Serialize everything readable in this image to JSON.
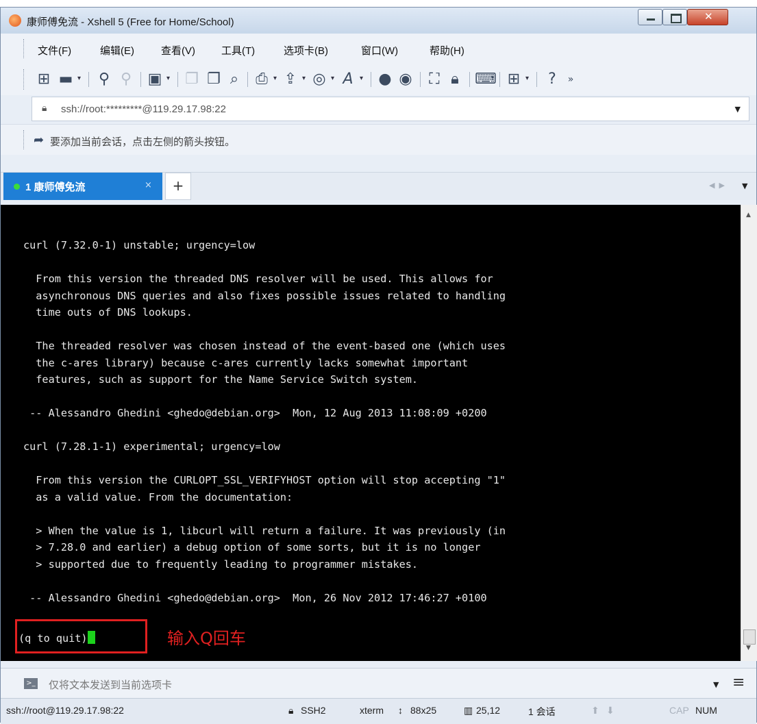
{
  "window": {
    "title": "康师傅免流 - Xshell 5 (Free for Home/School)"
  },
  "menu": [
    "文件(F)",
    "编辑(E)",
    "查看(V)",
    "工具(T)",
    "选项卡(B)",
    "窗口(W)",
    "帮助(H)"
  ],
  "toolbar": {
    "icons": [
      "new-session-icon",
      "open-folder-icon",
      "connect-icon",
      "disconnect-icon",
      "properties-icon",
      "copy-icon",
      "paste-icon",
      "find-icon",
      "print-icon",
      "transfer-icon",
      "globe-icon",
      "font-icon",
      "xftp-icon",
      "xagent-icon",
      "fullscreen-icon",
      "lock-icon",
      "keyboard-icon",
      "compose-icon",
      "help-icon",
      "overflow-icon"
    ]
  },
  "address": {
    "value": "ssh://root:*********@119.29.17.98:22"
  },
  "hint": {
    "text": "要添加当前会话，点击左侧的箭头按钮。"
  },
  "tabs": {
    "active_label": "1 康师傅免流",
    "add": "+"
  },
  "terminal": {
    "lines": [
      "curl (7.32.0-1) unstable; urgency=low",
      "",
      "  From this version the threaded DNS resolver will be used. This allows for",
      "  asynchronous DNS queries and also fixes possible issues related to handling",
      "  time outs of DNS lookups.",
      "",
      "  The threaded resolver was chosen instead of the event-based one (which uses",
      "  the c-ares library) because c-ares currently lacks somewhat important",
      "  features, such as support for the Name Service Switch system.",
      "",
      " -- Alessandro Ghedini <ghedo@debian.org>  Mon, 12 Aug 2013 11:08:09 +0200",
      "",
      "curl (7.28.1-1) experimental; urgency=low",
      "",
      "  From this version the CURLOPT_SSL_VERIFYHOST option will stop accepting \"1\"",
      "  as a valid value. From the documentation:",
      "",
      "  > When the value is 1, libcurl will return a failure. It was previously (in",
      "  > 7.28.0 and earlier) a debug option of some sorts, but it is no longer",
      "  > supported due to frequently leading to programmer mistakes.",
      "",
      " -- Alessandro Ghedini <ghedo@debian.org>  Mon, 26 Nov 2012 17:46:27 +0100"
    ],
    "prompt": "(q to quit)",
    "annotation": "输入Q回车"
  },
  "sendbar": {
    "placeholder": "仅将文本发送到当前选项卡"
  },
  "status": {
    "connection": "ssh://root@119.29.17.98:22",
    "protocol": "SSH2",
    "terminal_type": "xterm",
    "size": "88x25",
    "cursor": "25,12",
    "sessions": "1 会话",
    "caps": "CAP",
    "num": "NUM"
  },
  "colors": {
    "tab_active": "#1f7fd6",
    "cursor": "#1cd21c",
    "annotation": "#e02020",
    "terminal_bg": "#000000"
  }
}
